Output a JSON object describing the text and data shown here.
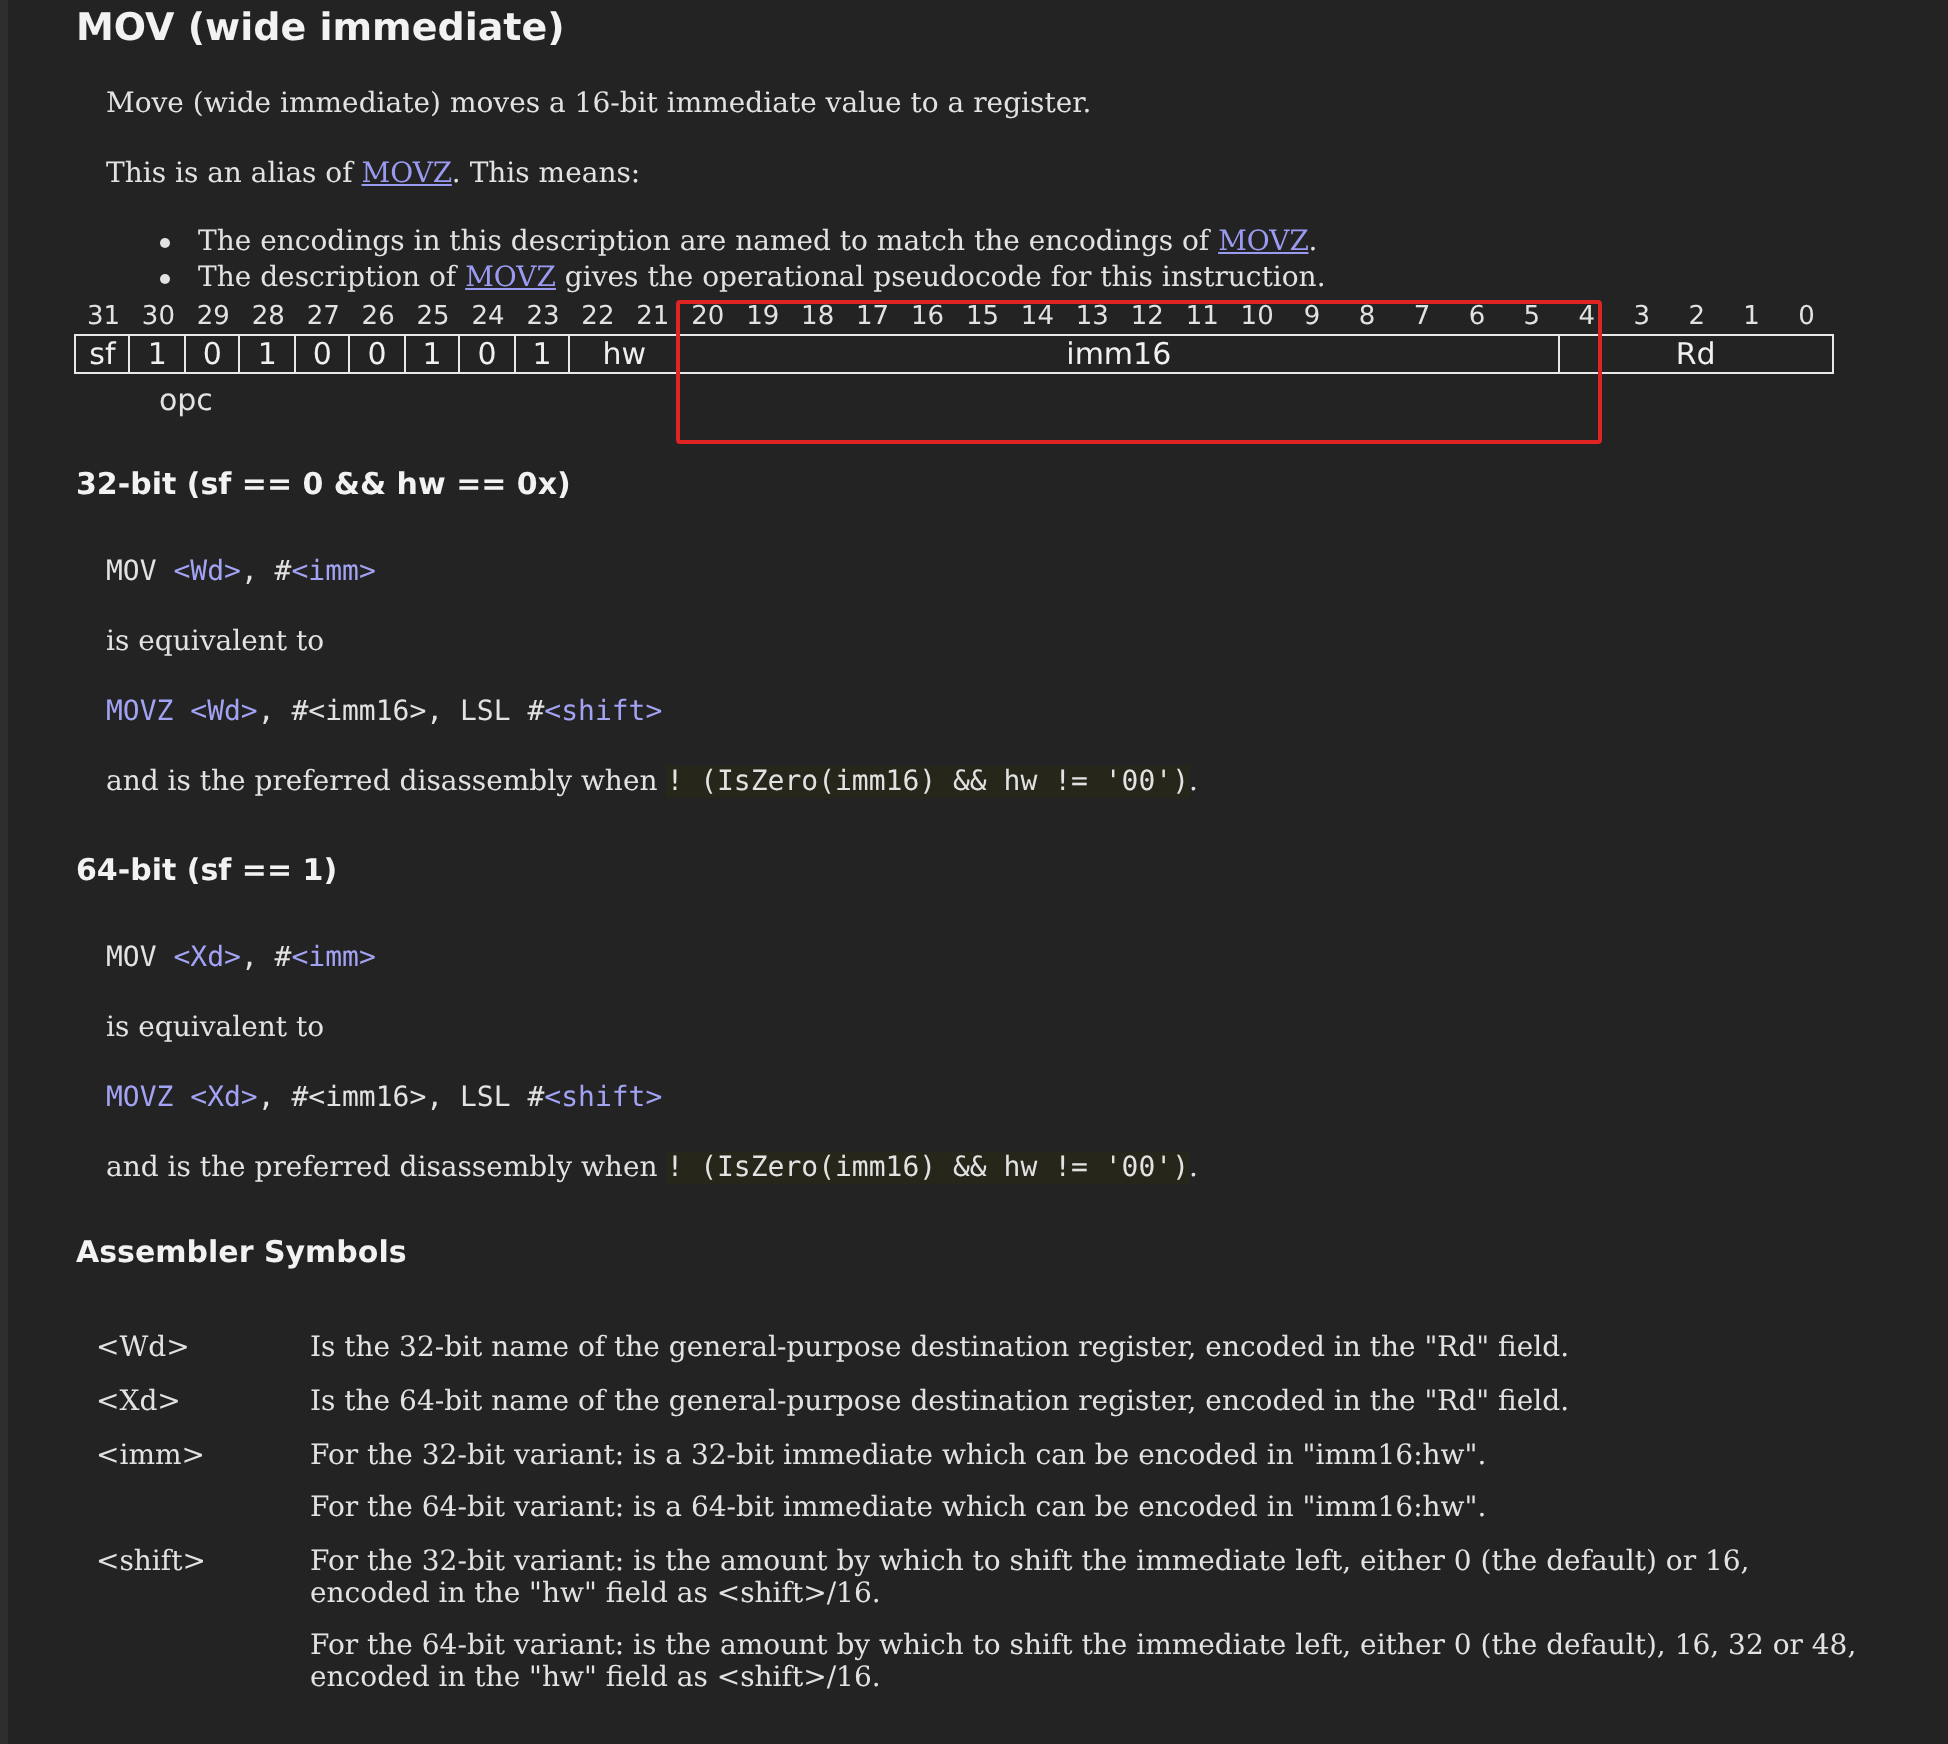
{
  "title": "MOV (wide immediate)",
  "intro": [
    [
      {
        "kind": "text",
        "text": "Move (wide immediate) moves a 16-bit immediate value to a register."
      }
    ],
    [
      {
        "kind": "text",
        "text": "This is an alias of "
      },
      {
        "kind": "link",
        "text": "MOVZ"
      },
      {
        "kind": "text",
        "text": ". This means:"
      }
    ]
  ],
  "bullets": [
    [
      {
        "kind": "text",
        "text": "The encodings in this description are named to match the encodings of "
      },
      {
        "kind": "link",
        "text": "MOVZ"
      },
      {
        "kind": "text",
        "text": "."
      }
    ],
    [
      {
        "kind": "text",
        "text": "The description of "
      },
      {
        "kind": "link",
        "text": "MOVZ"
      },
      {
        "kind": "text",
        "text": " gives the operational pseudocode for this instruction."
      }
    ]
  ],
  "encoding": {
    "fields": [
      {
        "bits": [
          "31"
        ],
        "value": "sf"
      },
      {
        "caption": "opc",
        "parts": [
          {
            "bits": [
              "30"
            ],
            "value": "1"
          },
          {
            "bits": [
              "29"
            ],
            "value": "0"
          }
        ]
      },
      {
        "bits": [
          "28"
        ],
        "value": "1"
      },
      {
        "bits": [
          "27"
        ],
        "value": "0"
      },
      {
        "bits": [
          "26"
        ],
        "value": "0"
      },
      {
        "bits": [
          "25"
        ],
        "value": "1"
      },
      {
        "bits": [
          "24"
        ],
        "value": "0"
      },
      {
        "bits": [
          "23"
        ],
        "value": "1"
      },
      {
        "bits": [
          "22",
          "21"
        ],
        "value": "hw"
      },
      {
        "bits": [
          "20",
          "19",
          "18",
          "17",
          "16",
          "15",
          "14",
          "13",
          "12",
          "11",
          "10",
          "9",
          "8",
          "7",
          "6",
          "5"
        ],
        "value": "imm16"
      },
      {
        "bits": [
          "4",
          "3",
          "2",
          "1",
          "0"
        ],
        "value": "Rd"
      }
    ]
  },
  "variants": [
    {
      "heading": "32-bit (sf == 0 && hw == 0x)",
      "lines": [
        {
          "kind": "code",
          "segments": [
            {
              "kind": "text",
              "text": "MOV "
            },
            {
              "kind": "symbol",
              "text": "<Wd>"
            },
            {
              "kind": "text",
              "text": ", #"
            },
            {
              "kind": "symbol",
              "text": "<imm>"
            }
          ]
        },
        {
          "kind": "prose",
          "segments": [
            {
              "kind": "text",
              "text": "is equivalent to"
            }
          ]
        },
        {
          "kind": "code",
          "segments": [
            {
              "kind": "symbol",
              "text": "MOVZ <Wd>"
            },
            {
              "kind": "text",
              "text": ", #<imm16>, LSL #"
            },
            {
              "kind": "symbol",
              "text": "<shift>"
            }
          ]
        },
        {
          "kind": "prose",
          "segments": [
            {
              "kind": "text",
              "text": "and is the preferred disassembly when "
            },
            {
              "kind": "code",
              "text": "! (IsZero(imm16) && hw != '00')"
            },
            {
              "kind": "text",
              "text": "."
            }
          ]
        }
      ]
    },
    {
      "heading": "64-bit (sf == 1)",
      "lines": [
        {
          "kind": "code",
          "segments": [
            {
              "kind": "text",
              "text": "MOV "
            },
            {
              "kind": "symbol",
              "text": "<Xd>"
            },
            {
              "kind": "text",
              "text": ", #"
            },
            {
              "kind": "symbol",
              "text": "<imm>"
            }
          ]
        },
        {
          "kind": "prose",
          "segments": [
            {
              "kind": "text",
              "text": "is equivalent to"
            }
          ]
        },
        {
          "kind": "code",
          "segments": [
            {
              "kind": "symbol",
              "text": "MOVZ <Xd>"
            },
            {
              "kind": "text",
              "text": ", #<imm16>, LSL #"
            },
            {
              "kind": "symbol",
              "text": "<shift>"
            }
          ]
        },
        {
          "kind": "prose",
          "segments": [
            {
              "kind": "text",
              "text": "and is the preferred disassembly when "
            },
            {
              "kind": "code",
              "text": "! (IsZero(imm16) && hw != '00')"
            },
            {
              "kind": "text",
              "text": "."
            }
          ]
        }
      ]
    }
  ],
  "symbols": {
    "heading": "Assembler Symbols",
    "rows": [
      {
        "symbol": "<Wd>",
        "descriptions": [
          "Is the 32-bit name of the general-purpose destination register, encoded in the \"Rd\" field."
        ]
      },
      {
        "symbol": "<Xd>",
        "descriptions": [
          "Is the 64-bit name of the general-purpose destination register, encoded in the \"Rd\" field."
        ]
      },
      {
        "symbol": "<imm>",
        "descriptions": [
          "For the 32-bit variant: is a 32-bit immediate which can be encoded in \"imm16:hw\".",
          "For the 64-bit variant: is a 64-bit immediate which can be encoded in \"imm16:hw\"."
        ]
      },
      {
        "symbol": "<shift>",
        "descriptions": [
          "For the 32-bit variant: is the amount by which to shift the immediate left, either 0 (the default) or 16, encoded in the \"hw\" field as <shift>/16.",
          "For the 64-bit variant: is the amount by which to shift the immediate left, either 0 (the default), 16, 32 or 48, encoded in the \"hw\" field as <shift>/16."
        ]
      }
    ]
  }
}
